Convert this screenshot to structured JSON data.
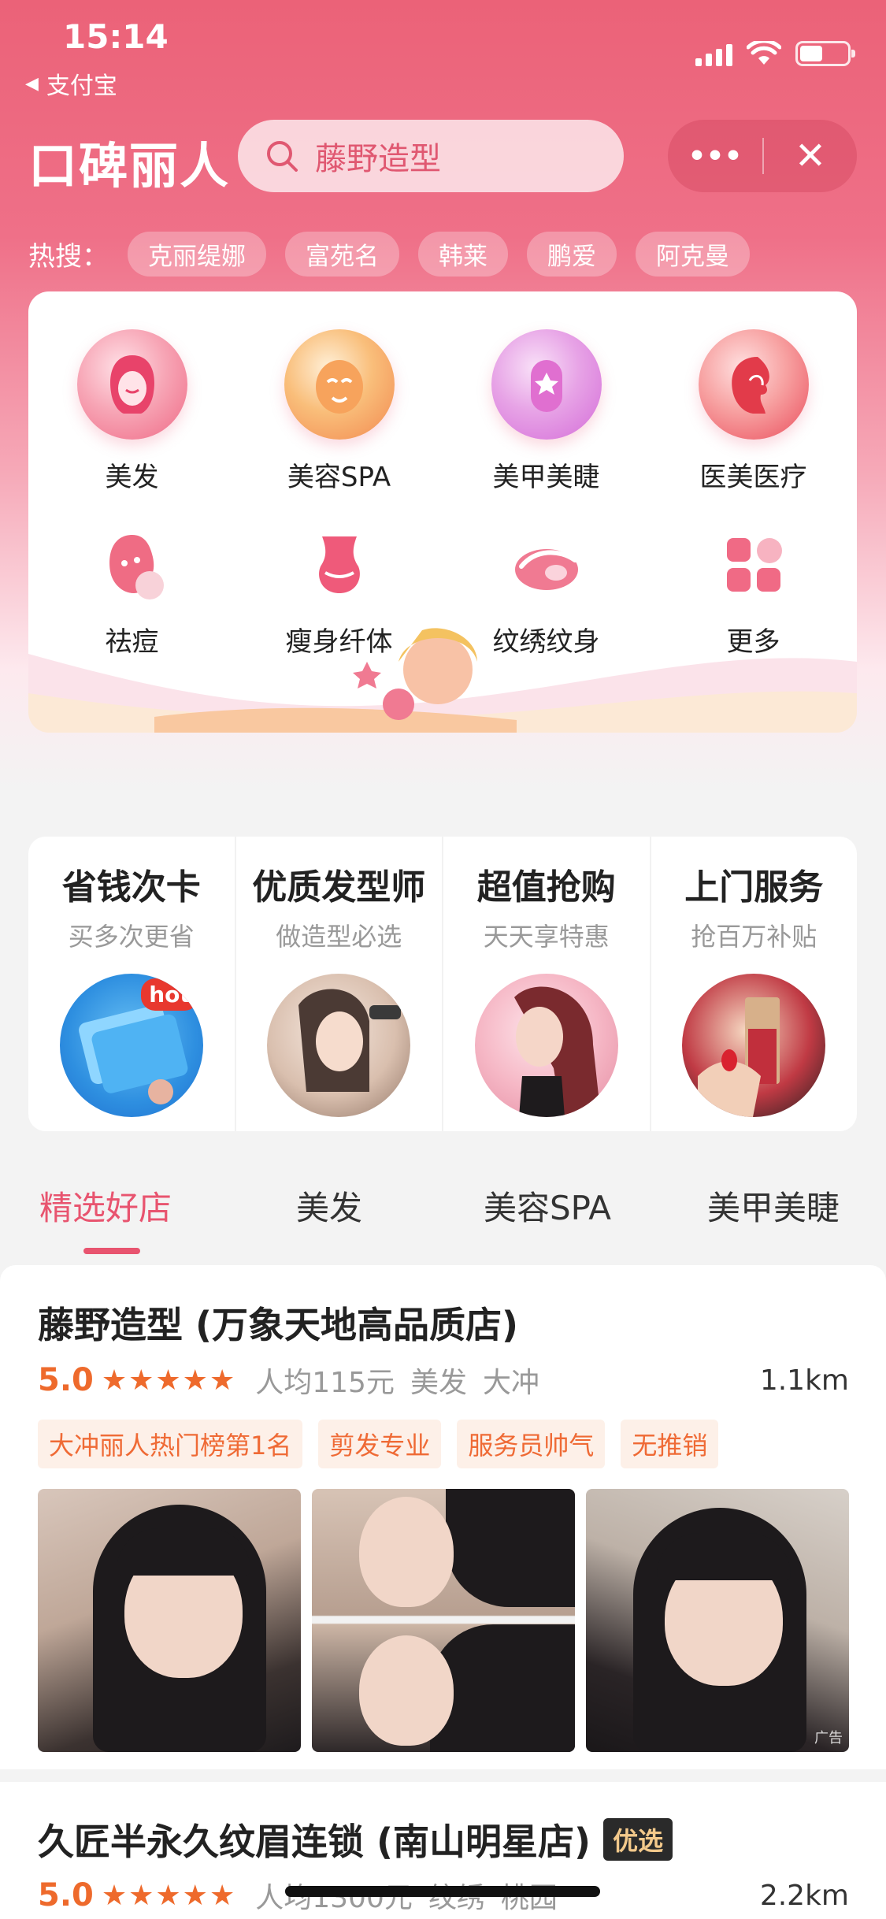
{
  "status_bar": {
    "time": "15:14",
    "back_app": "支付宝"
  },
  "header": {
    "brand": "口碑丽人",
    "search_value": "藤野造型",
    "capsule_more": "•••",
    "capsule_close": "✕"
  },
  "hot_search": {
    "label": "热搜：",
    "chips": [
      "克丽缇娜",
      "富苑名",
      "韩莱",
      "鹏爱",
      "阿克曼"
    ]
  },
  "categories": [
    {
      "label": "美发",
      "icon": "hair-icon"
    },
    {
      "label": "美容SPA",
      "icon": "spa-mask-icon"
    },
    {
      "label": "美甲美睫",
      "icon": "nail-icon"
    },
    {
      "label": "医美医疗",
      "icon": "medical-beauty-icon"
    },
    {
      "label": "祛痘",
      "icon": "acne-icon"
    },
    {
      "label": "瘦身纤体",
      "icon": "body-slim-icon"
    },
    {
      "label": "纹绣纹身",
      "icon": "tattoo-brow-icon"
    },
    {
      "label": "更多",
      "icon": "more-grid-icon"
    }
  ],
  "promos": [
    {
      "title": "省钱次卡",
      "subtitle": "买多次更省",
      "badge": "hot"
    },
    {
      "title": "优质发型师",
      "subtitle": "做造型必选"
    },
    {
      "title": "超值抢购",
      "subtitle": "天天享特惠"
    },
    {
      "title": "上门服务",
      "subtitle": "抢百万补贴"
    }
  ],
  "tabs": [
    "精选好店",
    "美发",
    "美容SPA",
    "美甲美睫"
  ],
  "active_tab": 0,
  "shops": [
    {
      "name": "藤野造型 (万象天地高品质店)",
      "score": "5.0",
      "stars": "★★★★★",
      "avg_price": "人均115元",
      "category": "美发",
      "area": "大冲",
      "distance": "1.1km",
      "tags": [
        "大冲丽人热门榜第1名",
        "剪发专业",
        "服务员帅气",
        "无推销"
      ],
      "ad_mark": "广告"
    },
    {
      "name": "久匠半永久纹眉连锁 (南山明星店)",
      "badge": "优选",
      "score": "5.0",
      "stars": "★★★★★",
      "avg_price": "人均1300元",
      "category": "纹绣",
      "area": "桃园",
      "distance": "2.2km"
    }
  ],
  "colors": {
    "accent": "#e8546f",
    "header_bg": "#eb6278",
    "rating": "#ee6a2c",
    "tag_bg": "#fdf0e8"
  }
}
